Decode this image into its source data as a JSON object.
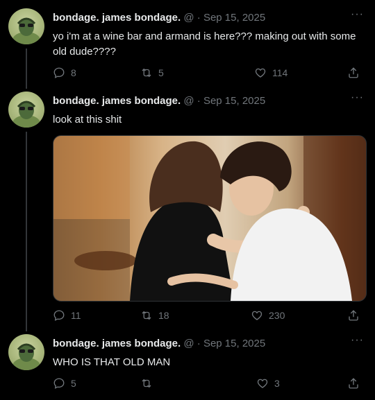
{
  "tweets": [
    {
      "display_name": "bondage. james bondage.",
      "handle": "@",
      "separator": "·",
      "date": "Sep 15, 2025",
      "text": "yo i'm at a wine bar and armand is here??? making out with some old dude????",
      "replies": "8",
      "retweets": "5",
      "likes": "114",
      "more": "···"
    },
    {
      "display_name": "bondage. james bondage.",
      "handle": "@",
      "separator": "·",
      "date": "Sep 15, 2025",
      "text": "look at this shit",
      "replies": "11",
      "retweets": "18",
      "likes": "230",
      "more": "···"
    },
    {
      "display_name": "bondage. james bondage.",
      "handle": "@",
      "separator": "·",
      "date": "Sep 15, 2025",
      "text": "WHO IS THAT OLD MAN",
      "replies": "5",
      "retweets": "",
      "likes": "3",
      "more": "···"
    }
  ],
  "icons": {
    "reply": "reply-icon",
    "retweet": "retweet-icon",
    "like": "heart-icon",
    "share": "share-icon",
    "more": "more-options-icon"
  },
  "colors": {
    "background": "#000000",
    "text": "#e7e9ea",
    "muted": "#71767b",
    "thread_line": "#333639"
  }
}
